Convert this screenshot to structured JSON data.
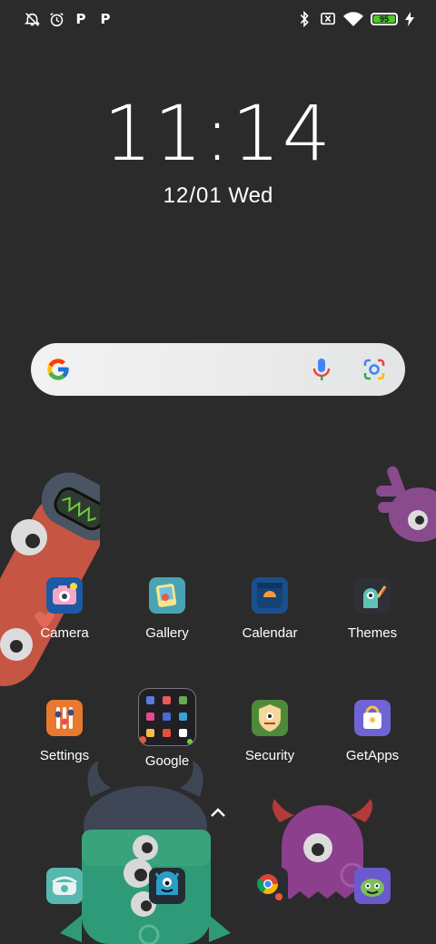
{
  "status_bar": {
    "left_icons": [
      "alarm-off-icon",
      "alarm-clock-icon",
      "p-notification-icon",
      "p-notification-icon"
    ],
    "right_icons": [
      "bluetooth-icon",
      "no-sim-icon",
      "wifi-icon",
      "battery-icon",
      "charging-icon"
    ],
    "battery_level": "95",
    "p_glyph": "P"
  },
  "clock": {
    "time": "11:14",
    "date": "12/01",
    "weekday": "Wed"
  },
  "search_bar": {
    "icons": [
      "google-logo-icon",
      "microphone-icon",
      "google-lens-icon"
    ]
  },
  "apps": {
    "row1": [
      {
        "label": "Camera"
      },
      {
        "label": "Gallery"
      },
      {
        "label": "Calendar"
      },
      {
        "label": "Themes"
      }
    ],
    "row2": [
      {
        "label": "Settings"
      },
      {
        "label": "Google"
      },
      {
        "label": "Security"
      },
      {
        "label": "GetApps"
      }
    ]
  },
  "dock": [
    "phone-app",
    "messaging-app",
    "chrome-app",
    "games-app"
  ],
  "colors": {
    "background": "#2b2b2b",
    "battery_fill": "#4cc62b",
    "google_blue": "#4285F4",
    "google_red": "#EA4335",
    "google_yellow": "#FBBC05",
    "google_green": "#34A853"
  }
}
